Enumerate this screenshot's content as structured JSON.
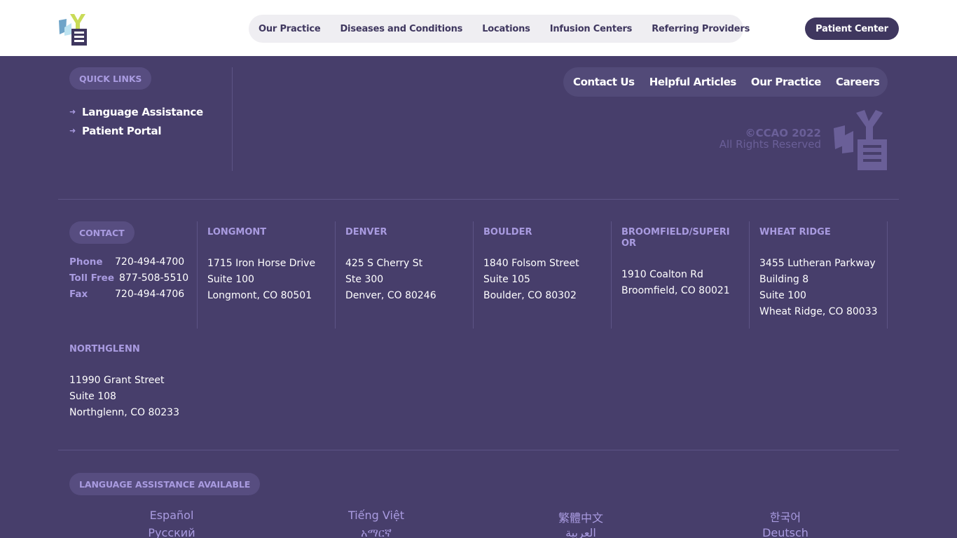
{
  "header": {
    "logo_alt": "CCAO logo",
    "nav": [
      "Our Practice",
      "Diseases and Conditions",
      "Locations",
      "Infusion Centers",
      "Referring Providers"
    ],
    "cta": "Patient Center"
  },
  "quick_links": {
    "label": "QUICK LINKS",
    "items": [
      "Language Assistance",
      "Patient Portal"
    ]
  },
  "footer_links": [
    "Contact Us",
    "Helpful Articles",
    "Our Practice",
    "Careers"
  ],
  "copyright": {
    "line1": "©CCAO 2022",
    "line2": "All Rights Reserved"
  },
  "contact": {
    "label": "CONTACT",
    "rows": [
      {
        "key": "Phone",
        "value": "720-494-4700"
      },
      {
        "key": "Toll Free",
        "value": "877-508-5510"
      },
      {
        "key": "Fax",
        "value": "720-494-4706"
      }
    ]
  },
  "locations": [
    {
      "name": "LONGMONT",
      "lines": [
        "1715 Iron Horse Drive",
        "Suite 100",
        "Longmont, CO 80501"
      ]
    },
    {
      "name": "DENVER",
      "lines": [
        "425 S Cherry St",
        "Ste 300",
        "Denver, CO 80246"
      ]
    },
    {
      "name": "BOULDER",
      "lines": [
        "1840 Folsom Street",
        "Suite 105",
        "Boulder, CO 80302"
      ]
    },
    {
      "name": "BROOMFIELD/SUPERIOR",
      "lines": [
        "1910 Coalton Rd",
        "Broomfield, CO 80021"
      ]
    },
    {
      "name": "WHEAT RIDGE",
      "lines": [
        "3455 Lutheran Parkway",
        "Building 8",
        "Suite 100",
        "Wheat Ridge, CO 80033"
      ]
    },
    {
      "name": "NORTHGLENN",
      "lines": [
        "11990 Grant Street",
        "Suite 108",
        "Northglenn, CO 80233"
      ]
    }
  ],
  "language": {
    "label": "LANGUAGE ASSISTANCE AVAILABLE",
    "items": [
      "Español",
      "Tiếng Việt",
      "繁體中文",
      "한국어",
      "Русский",
      "አማርኛ",
      "العربية",
      "Deutsch"
    ]
  },
  "colors": {
    "background": "#473e6b",
    "accent": "#a99be0",
    "header_bg": "#ffffff",
    "brand_dark": "#3f375f"
  }
}
